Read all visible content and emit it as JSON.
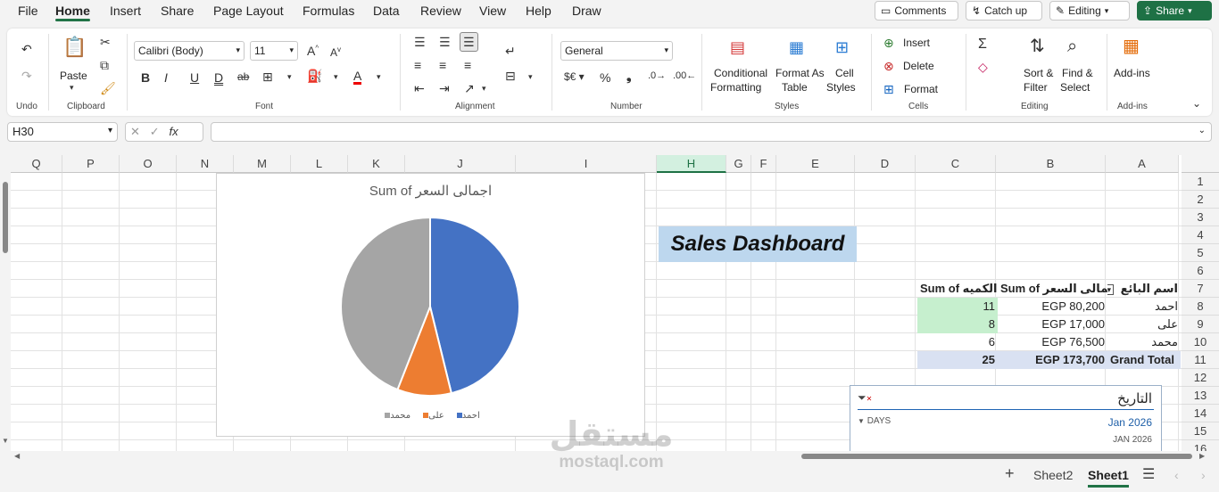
{
  "menu": {
    "items": [
      "File",
      "Home",
      "Insert",
      "Share",
      "Page Layout",
      "Formulas",
      "Data",
      "Review",
      "View",
      "Help",
      "Draw"
    ],
    "active": "Home",
    "comments": "Comments",
    "catch_up": "Catch up",
    "editing": "Editing",
    "share": "Share"
  },
  "ribbon": {
    "undo_label": "Undo",
    "paste_label": "Paste",
    "clipboard_label": "Clipboard",
    "font_name": "Calibri (Body)",
    "font_size": "11",
    "font_label": "Font",
    "alignment_label": "Alignment",
    "number_format": "General",
    "number_label": "Number",
    "conditional_1": "Conditional",
    "conditional_2": "Formatting",
    "format_as_1": "Format As",
    "format_as_2": "Table",
    "cell_1": "Cell",
    "cell_2": "Styles",
    "styles_label": "Styles",
    "insert": "Insert",
    "delete": "Delete",
    "format": "Format",
    "cells_label": "Cells",
    "sort_1": "Sort &",
    "sort_2": "Filter",
    "find_1": "Find &",
    "find_2": "Select",
    "editing_label": "Editing",
    "addins_1": "Add-ins",
    "addins_label": "Add-ins"
  },
  "formula_bar": {
    "name_box": "H30",
    "fx": "fx",
    "value": ""
  },
  "grid": {
    "columns": [
      "Q",
      "P",
      "O",
      "N",
      "M",
      "L",
      "K",
      "J",
      "I",
      "H",
      "G",
      "F",
      "E",
      "D",
      "C",
      "B",
      "A"
    ],
    "selected_column": "H",
    "rows": [
      "1",
      "2",
      "3",
      "4",
      "5",
      "6",
      "7",
      "8",
      "9",
      "10",
      "11",
      "12",
      "13",
      "14",
      "15",
      "16"
    ]
  },
  "dashboard": {
    "title": "Sales Dashboard"
  },
  "pivot": {
    "headers": [
      "اسم البائع",
      "Sum of اجمالى السعر",
      "Sum of الكميه"
    ],
    "rows": [
      {
        "name": "احمد",
        "price": "EGP 80,200",
        "qty": "11"
      },
      {
        "name": "على",
        "price": "EGP 17,000",
        "qty": "8"
      },
      {
        "name": "محمد",
        "price": "EGP 76,500",
        "qty": "6"
      }
    ],
    "total": {
      "name": "Grand Total",
      "price": "EGP 173,700",
      "qty": "25"
    }
  },
  "chart_data": {
    "type": "pie",
    "title": "Sum of اجمالى السعر",
    "categories": [
      "احمد",
      "على",
      "محمد"
    ],
    "values": [
      80200,
      17000,
      76500
    ],
    "colors": [
      "#4472c4",
      "#ed7d31",
      "#a5a5a5"
    ],
    "legend": "bottom"
  },
  "slicer": {
    "title": "التاريخ",
    "level": "DAYS",
    "month": "Jan 2026",
    "sub": "JAN 2026"
  },
  "sheets": {
    "tabs": [
      "Sheet2",
      "Sheet1"
    ],
    "active": "Sheet1"
  },
  "watermark": {
    "arabic": "مستقل",
    "latin": "mostaql.com"
  }
}
